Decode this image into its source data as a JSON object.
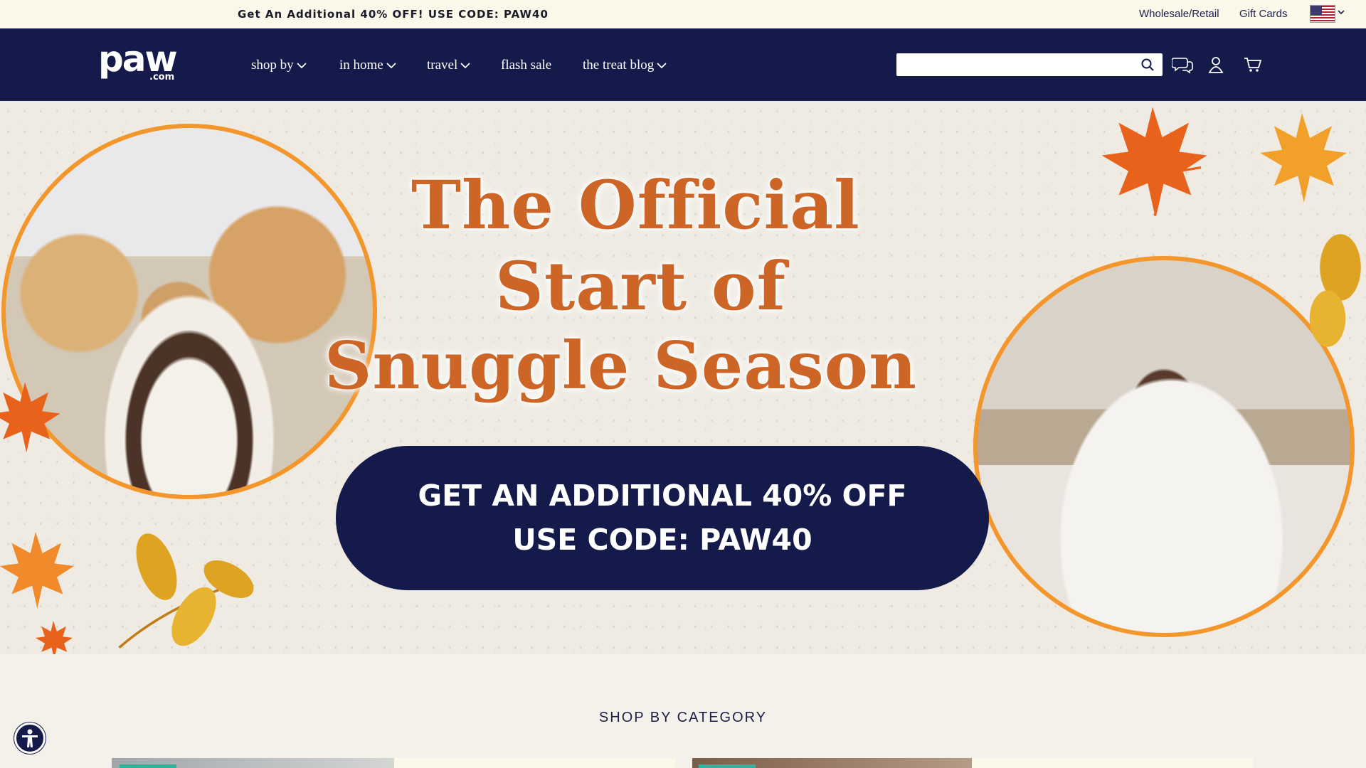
{
  "announcement": {
    "text": "Get An Additional 40% OFF! USE CODE: PAW40",
    "wholesale": "Wholesale/Retail",
    "gift_cards": "Gift Cards"
  },
  "nav": {
    "logo_text": "paw",
    "logo_suffix": ".com",
    "items": [
      {
        "label": "shop by",
        "dropdown": true
      },
      {
        "label": "in home",
        "dropdown": true
      },
      {
        "label": "travel",
        "dropdown": true
      },
      {
        "label": "flash sale",
        "dropdown": false
      },
      {
        "label": "the treat blog",
        "dropdown": true
      }
    ],
    "search_placeholder": "",
    "icons": [
      "chat-icon",
      "account-icon",
      "cart-icon"
    ]
  },
  "hero": {
    "title_lines": [
      "The Official",
      "Start of",
      "Snuggle Season"
    ],
    "cta_lines": [
      "GET AN ADDITIONAL 40% OFF",
      "USE CODE: PAW40"
    ]
  },
  "categories": {
    "title": "SHOP BY CATEGORY"
  },
  "colors": {
    "navy": "#141b4b",
    "orange_text": "#cc6525",
    "orange_ring": "#f3962b",
    "cream": "#fbf8ea",
    "teal_tag": "#2fb39a"
  }
}
